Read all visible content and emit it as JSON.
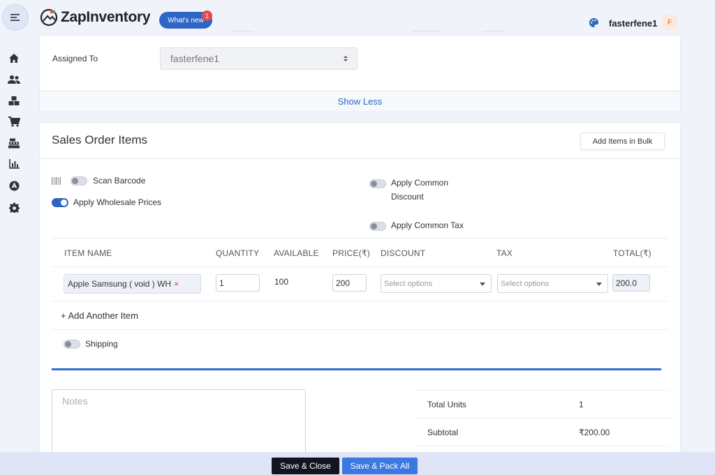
{
  "header": {
    "app_name": "ZapInventory",
    "whats_new_label": "What's new",
    "whats_new_count": "1",
    "username": "fasterfene1",
    "avatar_initial": "F"
  },
  "sidebar": {
    "items": [
      {
        "icon": "home-icon"
      },
      {
        "icon": "users-icon"
      },
      {
        "icon": "boxes-icon"
      },
      {
        "icon": "cart-icon"
      },
      {
        "icon": "cash-register-icon"
      },
      {
        "icon": "reports-icon"
      },
      {
        "icon": "app-store-icon"
      },
      {
        "icon": "gear-icon"
      }
    ]
  },
  "details": {
    "assigned_to_label": "Assigned To",
    "assigned_to_value": "fasterfene1",
    "show_less_label": "Show Less"
  },
  "items_section": {
    "title": "Sales Order Items",
    "add_bulk_label": "Add Items in Bulk",
    "scan_barcode_label": "Scan Barcode",
    "apply_wholesale_label": "Apply Wholesale Prices",
    "apply_common_discount_line1": "Apply Common",
    "apply_common_discount_line2": "Discount",
    "apply_common_tax_label": "Apply Common Tax",
    "columns": {
      "item_name": "ITEM NAME",
      "quantity": "QUANTITY",
      "available": "AVAILABLE",
      "price": "PRICE(₹)",
      "discount": "DISCOUNT",
      "tax": "TAX",
      "total": "TOTAL(₹)"
    },
    "row": {
      "item_name": "Apple Samsung ( void ) WH",
      "remove_symbol": "×",
      "quantity": "1",
      "available": "100",
      "price": "200",
      "discount_placeholder": "Select options",
      "tax_placeholder": "Select options",
      "total": "200.0"
    },
    "add_another_label": "+ Add Another Item",
    "shipping_label": "Shipping"
  },
  "summary": {
    "notes_placeholder": "Notes",
    "total_units_label": "Total Units",
    "total_units_value": "1",
    "subtotal_label": "Subtotal",
    "subtotal_value": "₹200.00"
  },
  "actions": {
    "save_close_label": "Save & Close",
    "save_pack_label": "Save & Pack All"
  },
  "colors": {
    "primary": "#2f66c5",
    "dark_button": "#10151f",
    "accent_blue": "#3b78e0"
  }
}
